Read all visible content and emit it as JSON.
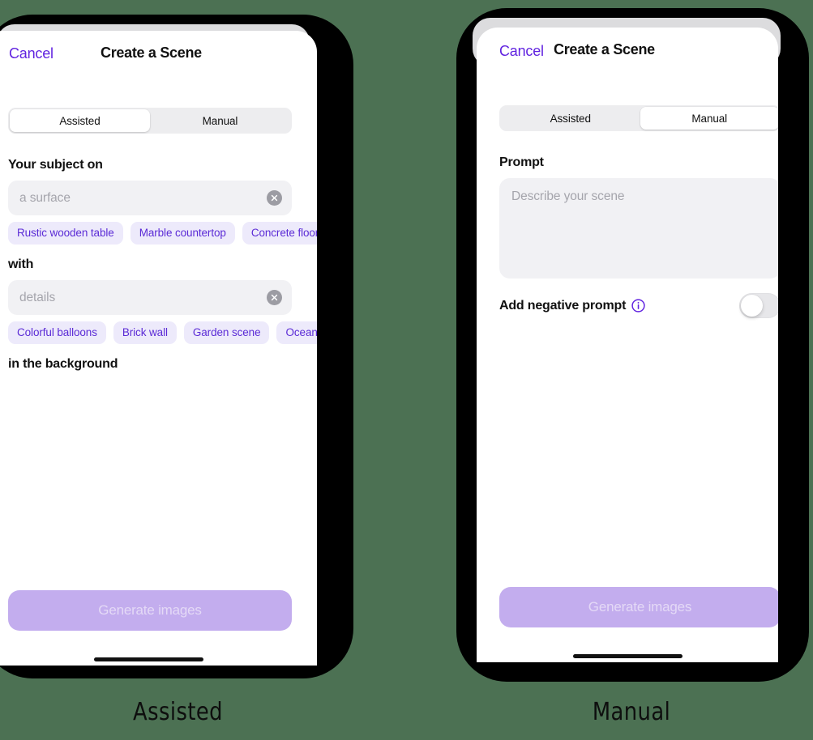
{
  "background_color": "#4C7153",
  "accent_color": "#6123E0",
  "chip_bg_color": "#EDEAFB",
  "chip_text_color": "#5B2BD6",
  "generate_button_color": "#C3ADEE",
  "panels": [
    {
      "caption": "Assisted",
      "nav": {
        "cancel_label": "Cancel",
        "title": "Create a Scene"
      },
      "segmented": {
        "options": [
          "Assisted",
          "Manual"
        ],
        "selected": "Assisted"
      },
      "fields": [
        {
          "label": "Your subject on",
          "value": "",
          "placeholder": "a surface",
          "clear_icon": "clear-circle-icon",
          "suggestions": [
            "Rustic wooden table",
            "Marble countertop",
            "Concrete floor"
          ]
        },
        {
          "label": "with",
          "value": "",
          "placeholder": "details",
          "clear_icon": "clear-circle-icon",
          "suggestions": [
            "Colorful balloons",
            "Brick wall",
            "Garden scene",
            "Ocean view"
          ]
        }
      ],
      "trailing_label": "in the background",
      "generate_label": "Generate images"
    },
    {
      "caption": "Manual",
      "nav": {
        "cancel_label": "Cancel",
        "title": "Create a Scene"
      },
      "segmented": {
        "options": [
          "Assisted",
          "Manual"
        ],
        "selected": "Manual"
      },
      "prompt": {
        "label": "Prompt",
        "value": "",
        "placeholder": "Describe your scene"
      },
      "negative_prompt": {
        "label": "Add negative prompt",
        "info_icon": "info-circle-icon",
        "toggle_state": "off"
      },
      "generate_label": "Generate images"
    }
  ]
}
